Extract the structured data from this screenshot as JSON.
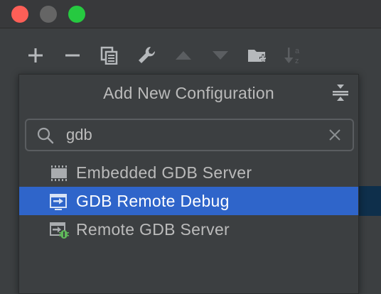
{
  "window": {
    "traffic_lights": [
      {
        "name": "close",
        "color": "#fe5f57"
      },
      {
        "name": "minimize",
        "color": "#656565"
      },
      {
        "name": "maximize",
        "color": "#26c940"
      }
    ]
  },
  "toolbar": {
    "buttons": [
      {
        "id": "add",
        "icon": "plus-icon"
      },
      {
        "id": "remove",
        "icon": "minus-icon"
      },
      {
        "id": "copy",
        "icon": "copy-icon"
      },
      {
        "id": "edit-defaults",
        "icon": "wrench-icon"
      },
      {
        "id": "move-up",
        "icon": "arrow-up-icon"
      },
      {
        "id": "move-down",
        "icon": "arrow-down-icon"
      },
      {
        "id": "new-folder",
        "icon": "folder-add-icon"
      },
      {
        "id": "sort",
        "icon": "sort-alpha-icon"
      }
    ]
  },
  "popup": {
    "title": "Add New Configuration",
    "search": {
      "value": "gdb",
      "placeholder": ""
    },
    "items": [
      {
        "label": "Embedded GDB Server",
        "icon": "embedded-chip-icon",
        "selected": false
      },
      {
        "label": "GDB Remote Debug",
        "icon": "remote-debug-icon",
        "selected": true
      },
      {
        "label": "Remote GDB Server",
        "icon": "remote-server-bug-icon",
        "selected": false
      }
    ]
  },
  "colors": {
    "selection": "#2f65ca",
    "background": "#3c3f41",
    "text": "#bbbbbb"
  }
}
